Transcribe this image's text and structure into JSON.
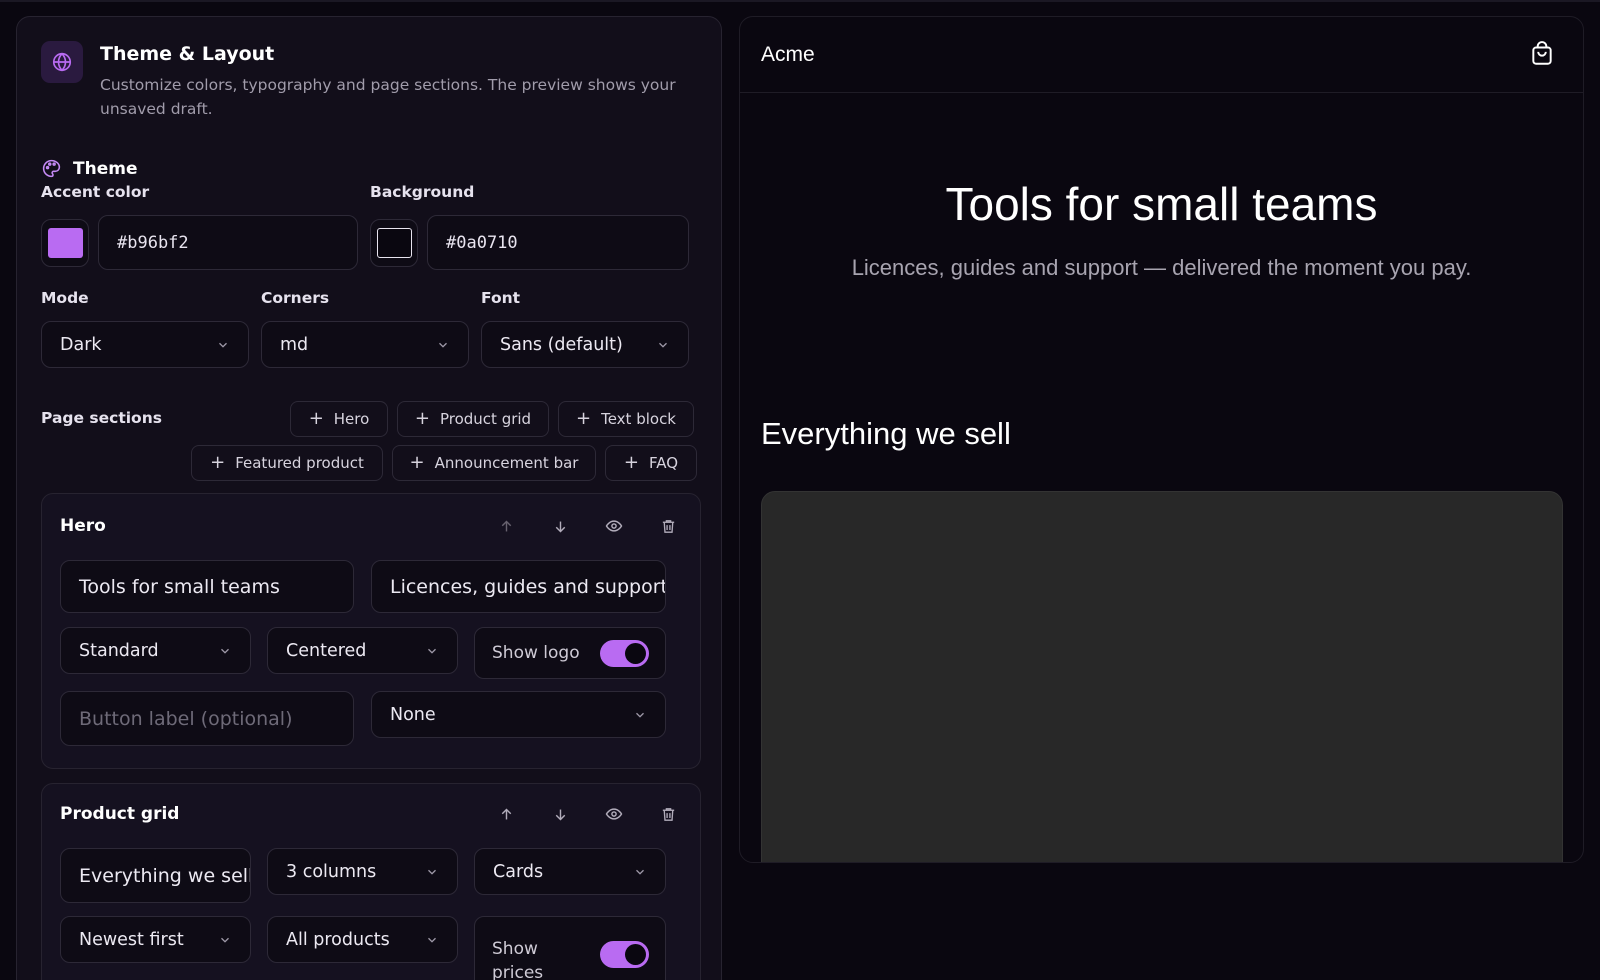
{
  "editor": {
    "title": "Theme & Layout",
    "description": "Customize colors, typography and page sections. The preview shows your unsaved draft.",
    "header_icon": "globe-icon",
    "theme": {
      "section_title": "Theme",
      "section_icon": "palette-icon",
      "accent_label": "Accent color",
      "accent_value": "#b96bf2",
      "background_label": "Background",
      "background_value": "#0a0710",
      "mode_label": "Mode",
      "mode_value": "Dark",
      "corners_label": "Corners",
      "corners_value": "md",
      "font_label": "Font",
      "font_value": "Sans (default)"
    },
    "sections": {
      "label": "Page sections",
      "add_buttons": [
        "Hero",
        "Product grid",
        "Text block",
        "Featured product",
        "Announcement bar",
        "FAQ"
      ]
    },
    "hero": {
      "title": "Hero",
      "heading_value": "Tools for small teams",
      "subheading_value": "Licences, guides and support — delivered the moment you pay.",
      "style_value": "Standard",
      "align_value": "Centered",
      "show_logo_label": "Show logo",
      "show_logo_on": true,
      "button_placeholder": "Button label (optional)",
      "link_value": "None"
    },
    "product_grid": {
      "title": "Product grid",
      "heading_value": "Everything we sell",
      "columns_value": "3 columns",
      "style_value": "Cards",
      "sort_value": "Newest first",
      "filter_value": "All products",
      "show_prices_label": "Show prices",
      "show_prices_on": true
    }
  },
  "preview": {
    "brand": "Acme",
    "cart_icon": "shopping-bag-icon",
    "hero_title": "Tools for small teams",
    "hero_subtitle": "Licences, guides and support — delivered the moment you pay.",
    "grid_title": "Everything we sell"
  },
  "colors": {
    "accent": "#b96bf2",
    "background": "#0a0710",
    "panel": "#120e1a",
    "border": "#2d2937"
  }
}
